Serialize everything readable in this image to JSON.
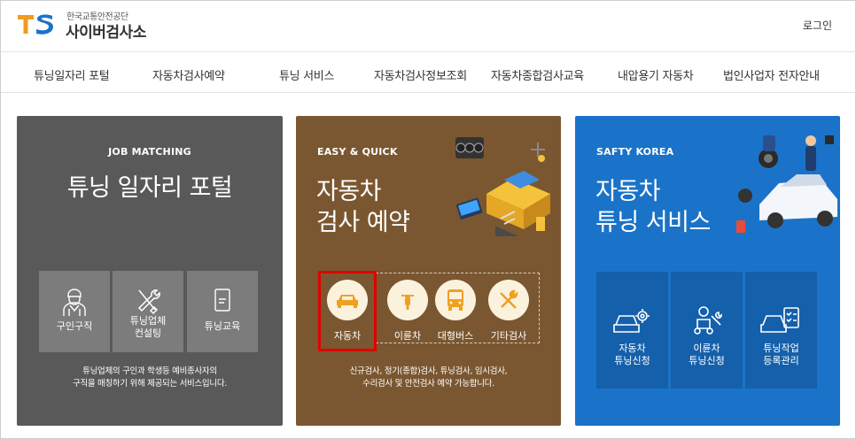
{
  "header": {
    "org_name": "한국교통안전공단",
    "site_name": "사이버검사소",
    "login": "로그인",
    "logo_colors": {
      "t": "#f29a1f",
      "s": "#1a73c8"
    }
  },
  "nav": {
    "items": [
      "튜닝일자리 포털",
      "자동차검사예약",
      "튜닝 서비스",
      "자동차검사정보조회",
      "자동차종합검사교육",
      "내압용기 자동차",
      "법인사업자 전자안내"
    ]
  },
  "cards": {
    "job": {
      "label": "JOB MATCHING",
      "title": "튜닝 일자리 포털",
      "background": "#595959",
      "tiles": [
        {
          "label": "구인구직",
          "icon": "worker-icon"
        },
        {
          "label_line1": "튜닝업체",
          "label_line2": "컨설팅",
          "icon": "tools-icon"
        },
        {
          "label": "튜닝교육",
          "icon": "document-icon"
        }
      ],
      "note_line1": "튜닝업체의 구인과 학생등 예비종사자의",
      "note_line2": "구직을 매칭하기 위해 제공되는 서비스입니다."
    },
    "inspection": {
      "label": "EASY & QUICK",
      "title_line1": "자동차",
      "title_line2": "검사 예약",
      "background": "#7a5730",
      "options": [
        {
          "label": "자동차",
          "icon": "car-icon",
          "selected": true
        },
        {
          "label": "이륜차",
          "icon": "motorcycle-icon"
        },
        {
          "label": "대형버스",
          "icon": "bus-icon"
        },
        {
          "label": "기타검사",
          "icon": "wrench-icon"
        }
      ],
      "note_line1": "신규검사, 정기(종합)검사, 튜닝검사, 임시검사,",
      "note_line2": "수리검사 및 안전검사 예약 가능합니다.",
      "highlight_color": "#e00000"
    },
    "tuning": {
      "label": "SAFTY KOREA",
      "title_line1": "자동차",
      "title_line2": "튜닝 서비스",
      "background": "#1a73c8",
      "tiles": [
        {
          "label_line1": "자동차",
          "label_line2": "튜닝신청",
          "icon": "car-gear-icon"
        },
        {
          "label_line1": "이륜차",
          "label_line2": "튜닝신청",
          "icon": "scooter-wrench-icon"
        },
        {
          "label_line1": "튜닝작업",
          "label_line2": "등록관리",
          "icon": "car-checklist-icon"
        }
      ]
    }
  }
}
